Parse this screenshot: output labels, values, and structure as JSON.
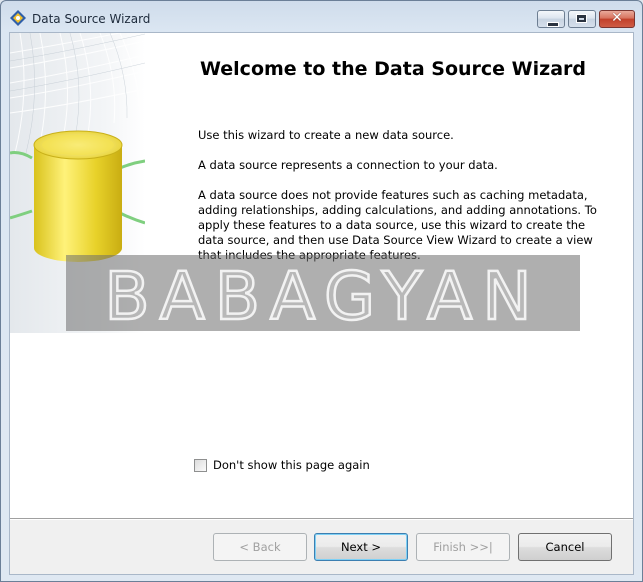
{
  "window": {
    "title": "Data Source Wizard",
    "icon": "wizard-app-icon"
  },
  "controls": {
    "minimize_icon": "minimize-icon",
    "maximize_icon": "maximize-icon",
    "close_glyph": "✕"
  },
  "content": {
    "heading": "Welcome to the Data Source Wizard",
    "paragraphs": [
      "Use this wizard to create a new data source.",
      "A data source represents a connection to your data.",
      "A data source does not provide features such as caching metadata, adding relationships, adding calculations, and adding annotations. To apply these features to a data source, use this wizard to create the data source, and then use Data Source View Wizard to create a view that includes the appropriate features."
    ],
    "watermark_text": "BABAGYAN"
  },
  "checkbox": {
    "label": "Don't show this page again",
    "checked": false
  },
  "buttons": {
    "back": "< Back",
    "next": "Next >",
    "finish": "Finish >>|",
    "cancel": "Cancel"
  },
  "colors": {
    "cylinder": "#e8d22a",
    "window_frame": "#cfdceb",
    "default_button_border": "#3c7fb1"
  }
}
